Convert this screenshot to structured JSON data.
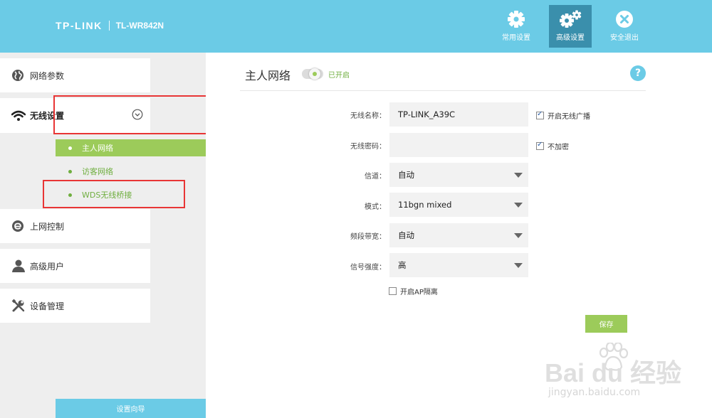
{
  "header": {
    "brand": "TP-LINK",
    "model": "TL-WR842N",
    "nav": [
      {
        "label": "常用设置",
        "icon": "gear-icon",
        "active": false
      },
      {
        "label": "高级设置",
        "icon": "gears-icon",
        "active": true
      },
      {
        "label": "安全退出",
        "icon": "close-circle-icon",
        "active": false
      }
    ]
  },
  "sidebar": {
    "items": [
      {
        "label": "网络参数",
        "icon": "globe-icon"
      },
      {
        "label": "无线设置",
        "icon": "wifi-icon"
      },
      {
        "label": "上网控制",
        "icon": "ie-icon"
      },
      {
        "label": "高级用户",
        "icon": "user-icon"
      },
      {
        "label": "设备管理",
        "icon": "tools-icon"
      }
    ],
    "submenu": [
      {
        "label": "主人网络",
        "active": true
      },
      {
        "label": "访客网络",
        "active": false
      },
      {
        "label": "WDS无线桥接",
        "active": false
      }
    ],
    "wizard_label": "设置向导"
  },
  "main": {
    "title": "主人网络",
    "toggle_status": "已开启",
    "help": "?",
    "form": {
      "ssid_label": "无线名称：",
      "ssid_value": "TP-LINK_A39C",
      "password_label": "无线密码：",
      "password_value": "",
      "channel_label": "信道：",
      "channel_value": "自动",
      "mode_label": "模式：",
      "mode_value": "11bgn mixed",
      "bandwidth_label": "频段带宽：",
      "bandwidth_value": "自动",
      "power_label": "信号强度：",
      "power_value": "高",
      "broadcast_label": "开启无线广播",
      "broadcast_checked": true,
      "noencrypt_label": "不加密",
      "noencrypt_checked": true,
      "ap_isolation_label": "开启AP隔离",
      "ap_isolation_checked": false
    },
    "save_label": "保存"
  },
  "watermark": {
    "main": "Bai du 经验",
    "sub": "jingyan.baidu.com"
  },
  "colors": {
    "header": "#6bcbe6",
    "active_nav": "#3a8fac",
    "green": "#9ccb5a",
    "highlight_red": "#e83535"
  }
}
